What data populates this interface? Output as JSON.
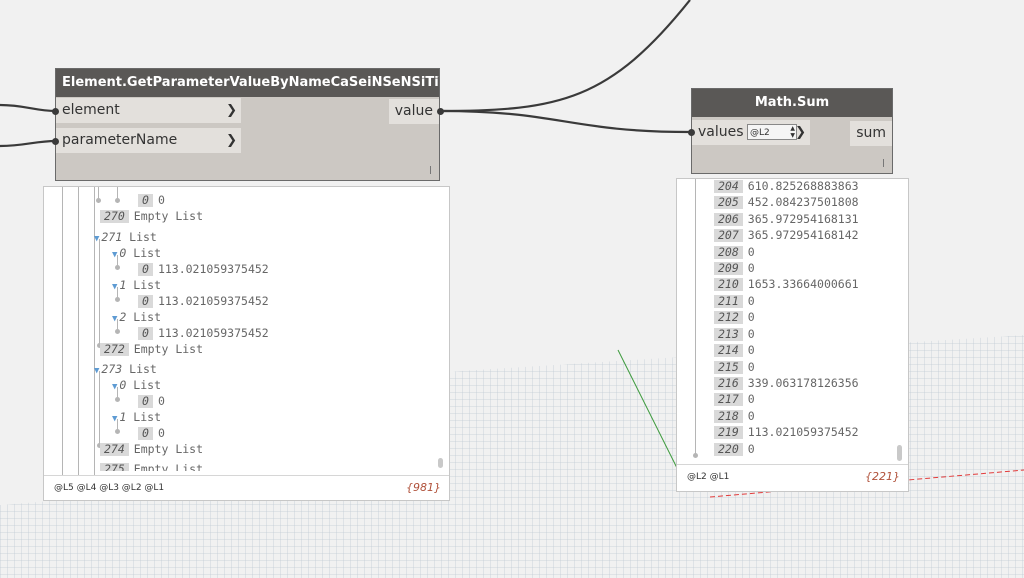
{
  "node_get_param": {
    "title": "Element.GetParameterValueByNameCaSeiNSeNSiTiVe",
    "inputs": [
      {
        "label": "element",
        "icon": "chevron-right-icon"
      },
      {
        "label": "parameterName",
        "icon": "chevron-right-icon"
      }
    ],
    "output": "value",
    "preview": {
      "levels": "@L5 @L4 @L3 @L2 @L1",
      "count": "{981}",
      "rows": [
        {
          "idx": "0",
          "text": "0"
        },
        {
          "idx": "270",
          "text": "Empty List"
        },
        {
          "idx": "271",
          "text": "List"
        },
        {
          "idx": "0",
          "text": "List"
        },
        {
          "idx": "0",
          "text": "113.021059375452"
        },
        {
          "idx": "1",
          "text": "List"
        },
        {
          "idx": "0",
          "text": "113.021059375452"
        },
        {
          "idx": "2",
          "text": "List"
        },
        {
          "idx": "0",
          "text": "113.021059375452"
        },
        {
          "idx": "272",
          "text": "Empty List"
        },
        {
          "idx": "273",
          "text": "List"
        },
        {
          "idx": "0",
          "text": "List"
        },
        {
          "idx": "0",
          "text": "0"
        },
        {
          "idx": "1",
          "text": "List"
        },
        {
          "idx": "0",
          "text": "0"
        },
        {
          "idx": "274",
          "text": "Empty List"
        },
        {
          "idx": "275",
          "text": "Empty List"
        }
      ]
    }
  },
  "node_math_sum": {
    "title": "Math.Sum",
    "input": {
      "label": "values",
      "lacing": "@L2",
      "icon": "chevron-right-icon"
    },
    "output": "sum",
    "preview": {
      "levels": "@L2 @L1",
      "count": "{221}",
      "rows": [
        {
          "idx": "204",
          "text": "610.825268883863"
        },
        {
          "idx": "205",
          "text": "452.084237501808"
        },
        {
          "idx": "206",
          "text": "365.972954168131"
        },
        {
          "idx": "207",
          "text": "365.972954168142"
        },
        {
          "idx": "208",
          "text": "0"
        },
        {
          "idx": "209",
          "text": "0"
        },
        {
          "idx": "210",
          "text": "1653.33664000661"
        },
        {
          "idx": "211",
          "text": "0"
        },
        {
          "idx": "212",
          "text": "0"
        },
        {
          "idx": "213",
          "text": "0"
        },
        {
          "idx": "214",
          "text": "0"
        },
        {
          "idx": "215",
          "text": "0"
        },
        {
          "idx": "216",
          "text": "339.063178126356"
        },
        {
          "idx": "217",
          "text": "0"
        },
        {
          "idx": "218",
          "text": "0"
        },
        {
          "idx": "219",
          "text": "113.021059375452"
        },
        {
          "idx": "220",
          "text": "0"
        }
      ]
    }
  },
  "colors": {
    "node_header": "#5a5856",
    "node_body": "#ccc8c3",
    "count_text": "#b0513a",
    "tree_toggle": "#5e9bd3"
  }
}
